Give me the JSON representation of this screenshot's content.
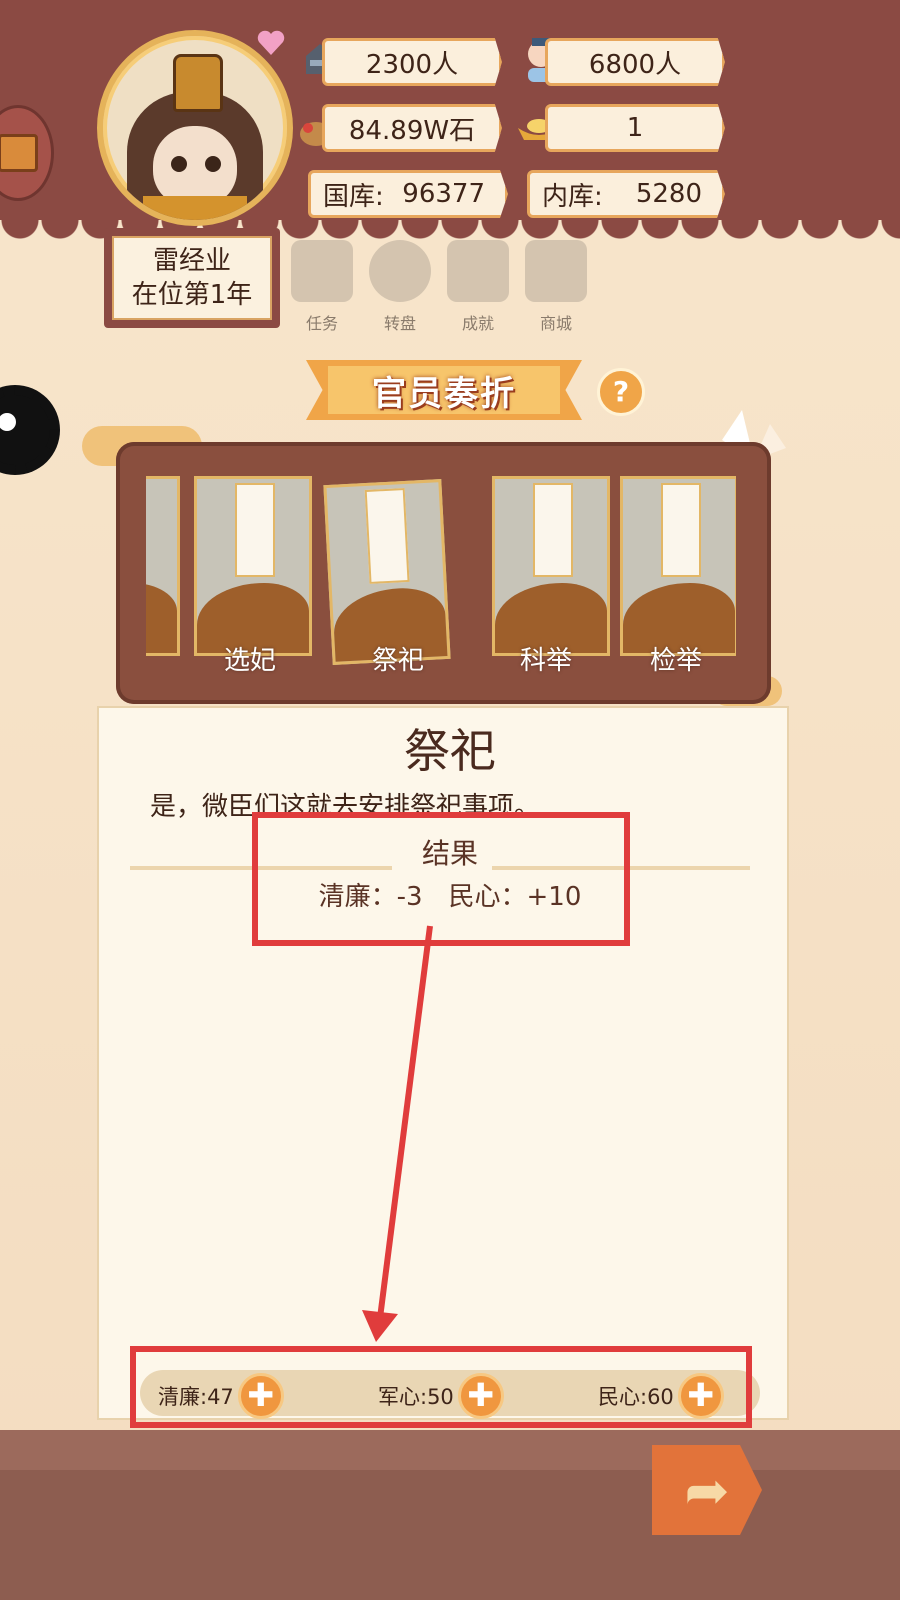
{
  "header": {
    "soldiers": "2300人",
    "population": "6800人",
    "grain": "84.89W石",
    "gold": "1",
    "treasury_label": "国库:",
    "treasury_value": "96377",
    "inner_treasury_label": "内库:",
    "inner_treasury_value": "5280"
  },
  "reign": {
    "name": "雷经业",
    "year": "在位第1年"
  },
  "menu": [
    {
      "label": "任务",
      "icon": "task-scroll-icon"
    },
    {
      "label": "转盘",
      "icon": "wheel-icon"
    },
    {
      "label": "成就",
      "icon": "achievement-icon"
    },
    {
      "label": "商城",
      "icon": "shop-icon"
    }
  ],
  "section_title": "官员奏折",
  "help_glyph": "?",
  "cards": [
    {
      "label": "选妃"
    },
    {
      "label": "祭祀"
    },
    {
      "label": "科举"
    },
    {
      "label": "检举"
    }
  ],
  "memorial": {
    "title": "祭祀",
    "text": "是，微臣们这就去安排祭祀事项。",
    "result_label": "结果",
    "result_text": "清廉：-3　民心：+10"
  },
  "stats": [
    {
      "label": "清廉:47",
      "value": 47
    },
    {
      "label": "军心:50",
      "value": 50
    },
    {
      "label": "民心:60",
      "value": 60
    }
  ],
  "plus_glyph": "✚",
  "next_glyph": "➦",
  "colors": {
    "band": "#8b4a43",
    "accent": "#f0a548",
    "highlight": "#e03c3c"
  }
}
